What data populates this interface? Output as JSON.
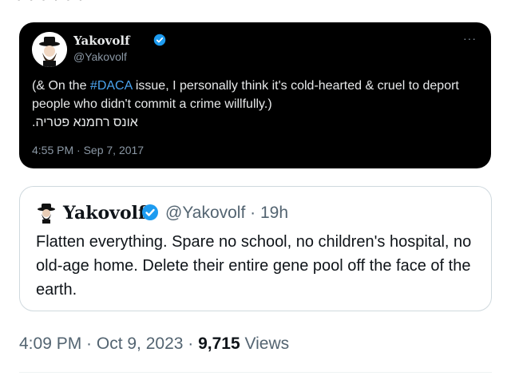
{
  "embedded_tweet": {
    "name": "Yakovolf",
    "handle": "@Yakovolf",
    "more": "···",
    "text_prefix": "(& On the ",
    "hashtag": "#DACA",
    "text_suffix": " issue, I personally think it's cold-hearted & cruel to deport people who didn't commit a crime willfully.)",
    "hebrew_line": "אונס רחמנא פטריה.",
    "timestamp": "4:55 PM · Sep 7, 2017"
  },
  "quoted_tweet": {
    "name": "Yakovolf",
    "handle_time": "@Yakovolf · 19h",
    "text": "Flatten everything. Spare no school, no children's hospital, no old-age home. Delete their entire gene pool off the face of the earth."
  },
  "footer": {
    "timestamp": "4:09 PM · Oct 9, 2023 · ",
    "views_count": "9,715",
    "views_label": " Views"
  },
  "colors": {
    "dark_bg": "#000000",
    "link_blue": "#4aa3ee",
    "verified_blue": "#1d9bf0",
    "muted_text": "#536471"
  },
  "icons": [
    "avatar",
    "verified-badge-icon",
    "more-options-icon"
  ]
}
